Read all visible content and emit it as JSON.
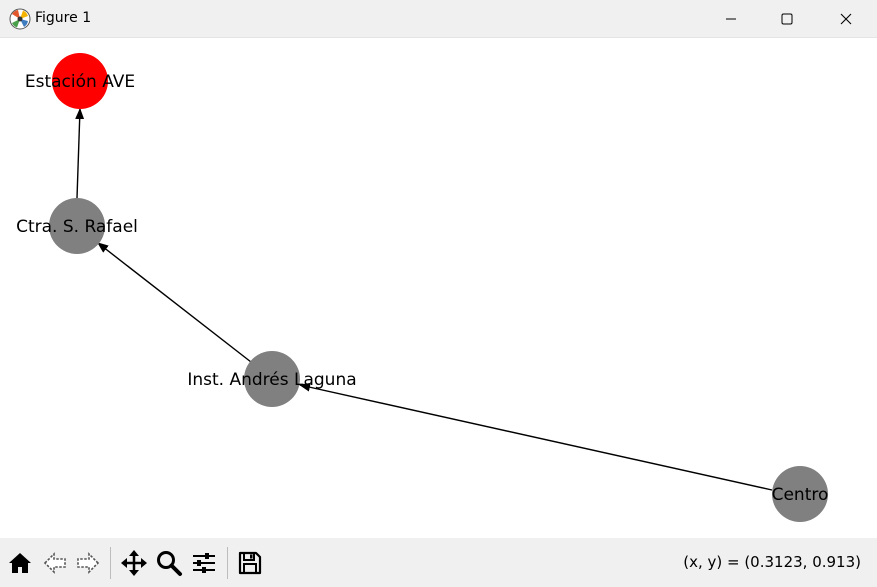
{
  "window": {
    "title": "Figure 1",
    "minimize_icon": "minimize-icon",
    "maximize_icon": "maximize-icon",
    "close_icon": "close-icon"
  },
  "graph": {
    "nodes": [
      {
        "id": "estacion-ave",
        "label": "Estación AVE",
        "color": "#ff0000"
      },
      {
        "id": "ctra-s-rafael",
        "label": "Ctra. S. Rafael",
        "color": "#808080"
      },
      {
        "id": "inst-andres-laguna",
        "label": "Inst. Andrés Laguna",
        "color": "#808080"
      },
      {
        "id": "centro",
        "label": "Centro",
        "color": "#808080"
      }
    ],
    "edges": [
      {
        "from": "centro",
        "to": "inst-andres-laguna"
      },
      {
        "from": "inst-andres-laguna",
        "to": "ctra-s-rafael"
      },
      {
        "from": "ctra-s-rafael",
        "to": "estacion-ave"
      }
    ]
  },
  "toolbar": {
    "buttons": [
      "home-icon",
      "back-icon",
      "forward-icon",
      "pan-icon",
      "zoom-icon",
      "configure-subplots-icon",
      "save-icon"
    ],
    "coords": "(x, y) = (0.3123, 0.913)"
  }
}
